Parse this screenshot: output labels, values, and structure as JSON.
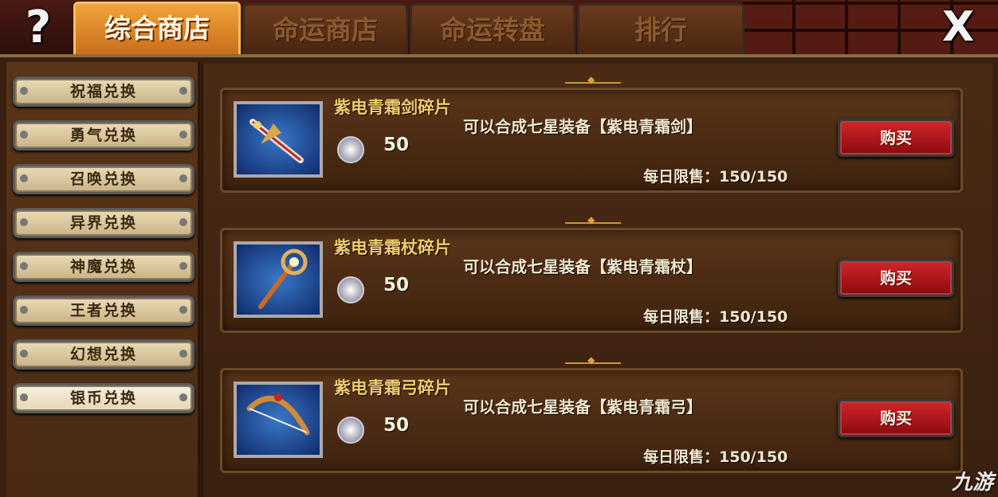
{
  "header": {
    "help_label": "?",
    "close_label": "X",
    "tabs": [
      {
        "label": "综合商店",
        "active": true
      },
      {
        "label": "命运商店",
        "active": false
      },
      {
        "label": "命运转盘",
        "active": false
      },
      {
        "label": "排行",
        "active": false
      }
    ]
  },
  "sidebar": {
    "items": [
      {
        "label": "祝福兑换"
      },
      {
        "label": "勇气兑换"
      },
      {
        "label": "召唤兑换"
      },
      {
        "label": "异界兑换"
      },
      {
        "label": "神魔兑换"
      },
      {
        "label": "王者兑换"
      },
      {
        "label": "幻想兑换"
      },
      {
        "label": "银币兑换",
        "selected": true
      }
    ]
  },
  "shop": {
    "items": [
      {
        "name": "紫电青霜剑碎片",
        "desc": "可以合成七星装备【紫电青霜剑】",
        "price": "50",
        "limit": "每日限售：150/150",
        "buy_label": "购买",
        "icon": "sword-icon"
      },
      {
        "name": "紫电青霜杖碎片",
        "desc": "可以合成七星装备【紫电青霜杖】",
        "price": "50",
        "limit": "每日限售：150/150",
        "buy_label": "购买",
        "icon": "staff-icon"
      },
      {
        "name": "紫电青霜弓碎片",
        "desc": "可以合成七星装备【紫电青霜弓】",
        "price": "50",
        "limit": "每日限售：150/150",
        "buy_label": "购买",
        "icon": "bow-icon"
      }
    ],
    "currency_icon": "silver-coin-icon"
  },
  "watermark": "九游",
  "colors": {
    "accent": "#e08a28",
    "buy": "#b8181c",
    "title": "#f0cc70"
  }
}
